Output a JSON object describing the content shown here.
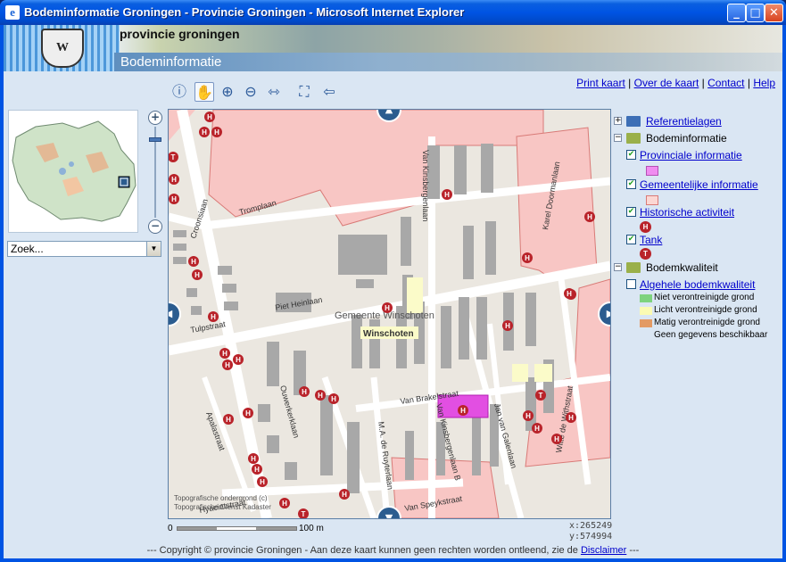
{
  "window": {
    "title": "Bodeminformatie Groningen - Provincie Groningen - Microsoft Internet Explorer",
    "app_icon": "ie-icon"
  },
  "banner": {
    "org": "provincie groningen",
    "section": "Bodeminformatie"
  },
  "top_links": {
    "print": "Print kaart",
    "about": "Over de kaart",
    "contact": "Contact",
    "help": "Help",
    "sep": "|"
  },
  "toolbar": {
    "tools": [
      "info-icon",
      "pan-hand-icon",
      "zoom-in-icon",
      "zoom-out-icon",
      "measure-icon",
      "full-extent-icon",
      "back-icon"
    ],
    "active": "pan-hand-icon"
  },
  "search": {
    "value": "Zoek..."
  },
  "map": {
    "streets": [
      "Tromplaan",
      "Croonsiaan",
      "Piet Heinlaan",
      "Tulpstraat",
      "Van Kinsbergenlaan",
      "Karel Doormanlaan",
      "Van Brakelstraat",
      "Jan van Galenlaan",
      "Witte de Withstraat",
      "M.A. de Ruyterlaan",
      "Van Kinsbergenlaan B",
      "Ouwerkerklaan",
      "Apalastraat",
      "Hyacintstraat",
      "Van Speykstraat"
    ],
    "town_label": "Gemeente Winschoten",
    "town_highlight": "Winschoten",
    "attribution_1": "Topografische ondergrond (c)",
    "attribution_2": "Topografische Dienst Kadaster"
  },
  "scale": {
    "zero": "0",
    "distance": "100 m"
  },
  "coords": {
    "x": "x:265249",
    "y": "y:574994"
  },
  "legend": {
    "groups": [
      {
        "label": "Referentielagen",
        "state": "collapsed",
        "link": true
      },
      {
        "label": "Bodeminformatie",
        "state": "expanded",
        "link": false
      },
      {
        "label": "Bodemkwaliteit",
        "state": "expanded",
        "link": false
      }
    ],
    "layers": [
      {
        "label": "Provinciale informatie",
        "checked": true,
        "swatch": "#f08cf0"
      },
      {
        "label": "Gemeentelijke informatie",
        "checked": true,
        "swatch": "#fcd7d3"
      },
      {
        "label": "Historische activiteit",
        "checked": true,
        "icon": "H"
      },
      {
        "label": "Tank",
        "checked": true,
        "icon": "T"
      },
      {
        "label": "Algehele bodemkwaliteit",
        "checked": false
      }
    ],
    "quality": [
      {
        "label": "Niet verontreinigde grond",
        "color": "#7ed37e"
      },
      {
        "label": "Licht verontreinigde grond",
        "color": "#fbfbb3"
      },
      {
        "label": "Matig verontreinigde grond",
        "color": "#e39a64"
      },
      {
        "label": "Geen gegevens beschikbaar",
        "color": ""
      }
    ]
  },
  "footer": {
    "text": "--- Copyright © provincie Groningen - Aan deze kaart kunnen geen rechten worden ontleend, zie de",
    "link": "Disclaimer",
    "end": "---"
  }
}
